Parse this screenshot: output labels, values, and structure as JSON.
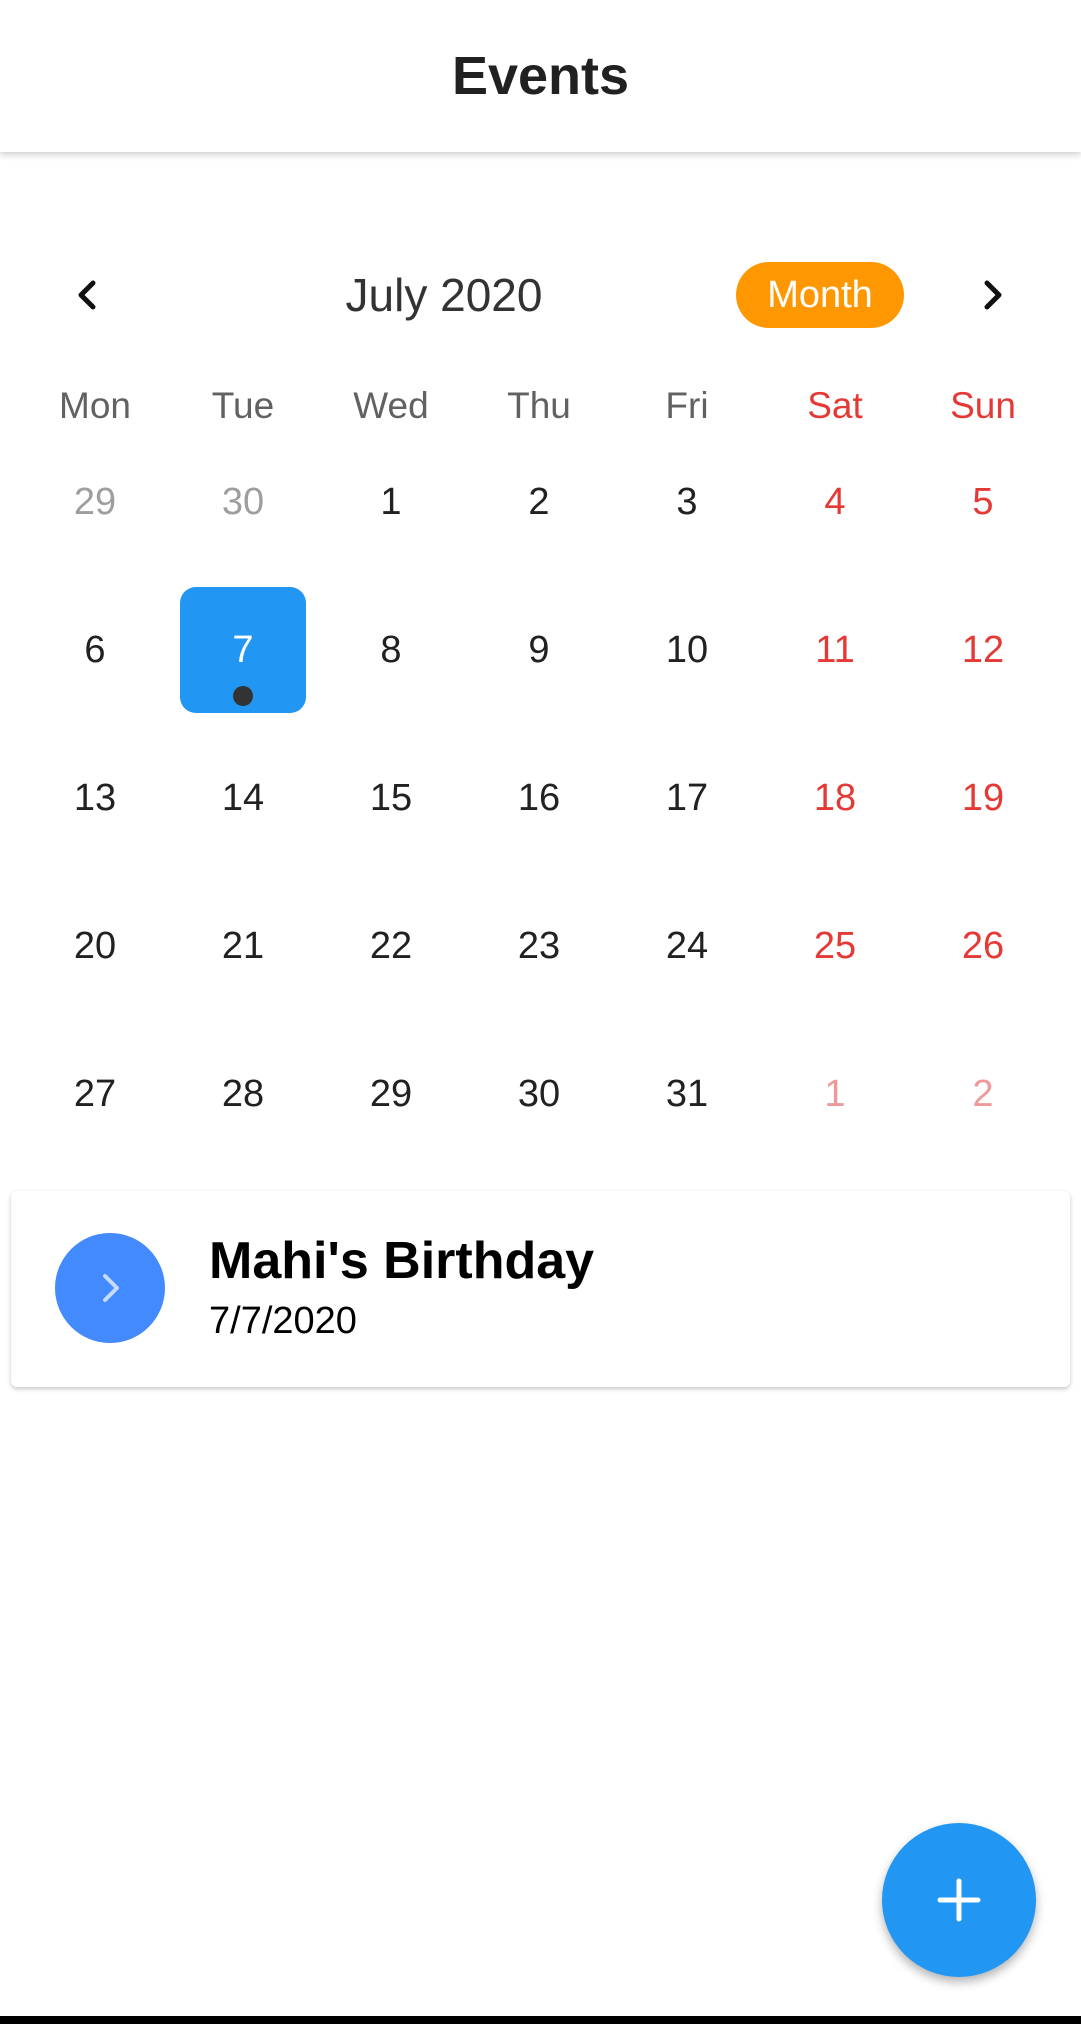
{
  "appbar": {
    "title": "Events"
  },
  "calendar": {
    "month_label": "July 2020",
    "format_button": "Month",
    "prev_icon": "chevron-left-icon",
    "next_icon": "chevron-right-icon",
    "weekdays": [
      "Mon",
      "Tue",
      "Wed",
      "Thu",
      "Fri",
      "Sat",
      "Sun"
    ],
    "weeks": [
      [
        "29",
        "30",
        "1",
        "2",
        "3",
        "4",
        "5"
      ],
      [
        "6",
        "7",
        "8",
        "9",
        "10",
        "11",
        "12"
      ],
      [
        "13",
        "14",
        "15",
        "16",
        "17",
        "18",
        "19"
      ],
      [
        "20",
        "21",
        "22",
        "23",
        "24",
        "25",
        "26"
      ],
      [
        "27",
        "28",
        "29",
        "30",
        "31",
        "1",
        "2"
      ]
    ],
    "selected_day": "7",
    "colors": {
      "selected": "#2196f3",
      "weekend": "#e53935",
      "format_button": "#ff9800"
    }
  },
  "events": [
    {
      "title": "Mahi's Birthday",
      "date": "7/7/2020",
      "icon": "chevron-right-icon"
    }
  ],
  "fab": {
    "icon": "plus-icon",
    "color": "#2196f3"
  }
}
